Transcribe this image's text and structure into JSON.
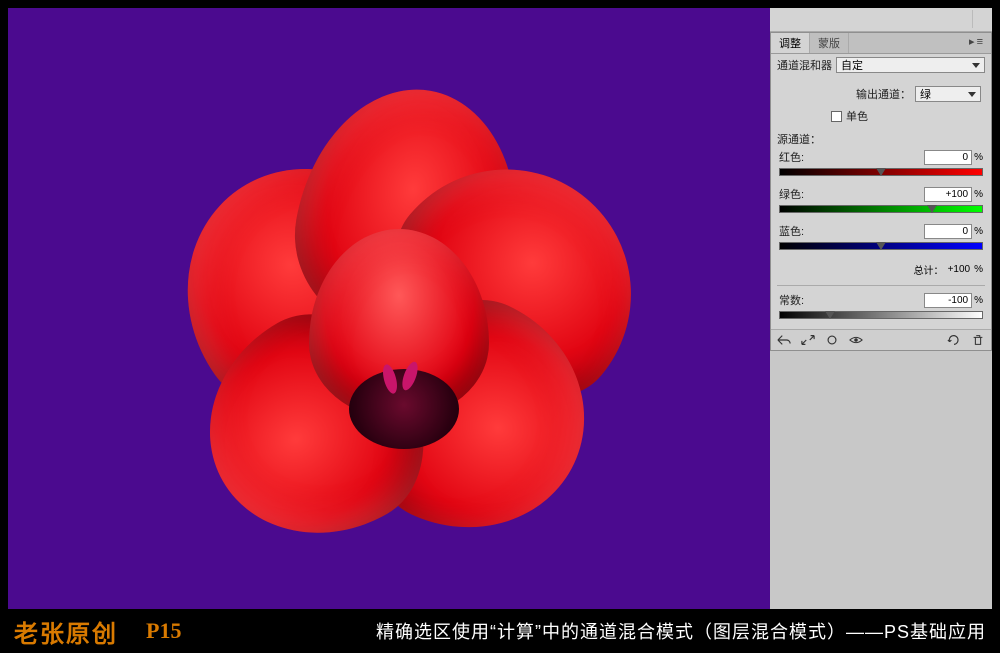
{
  "panel": {
    "tabs": {
      "active": "调整",
      "inactive": "蒙版",
      "menu_glyph": "▸≡"
    },
    "mixer_label": "通道混和器",
    "preset": "自定",
    "output_label": "输出通道：",
    "output_value": "绿",
    "mono_label": "单色",
    "source_label": "源通道：",
    "pct": "%",
    "sliders": {
      "red": {
        "label": "红色:",
        "value": "0",
        "thumb_pct": 50
      },
      "green": {
        "label": "绿色:",
        "value": "+100",
        "thumb_pct": 75
      },
      "blue": {
        "label": "蓝色:",
        "value": "0",
        "thumb_pct": 50
      }
    },
    "total_label": "总计：",
    "total_value": "+100",
    "constant": {
      "label": "常数:",
      "value": "-100",
      "thumb_pct": 25
    }
  },
  "caption": {
    "brand": "老张原创",
    "page": "P15",
    "title": "精确选区使用“计算”中的通道混合模式（图层混合模式）——PS基础应用"
  }
}
